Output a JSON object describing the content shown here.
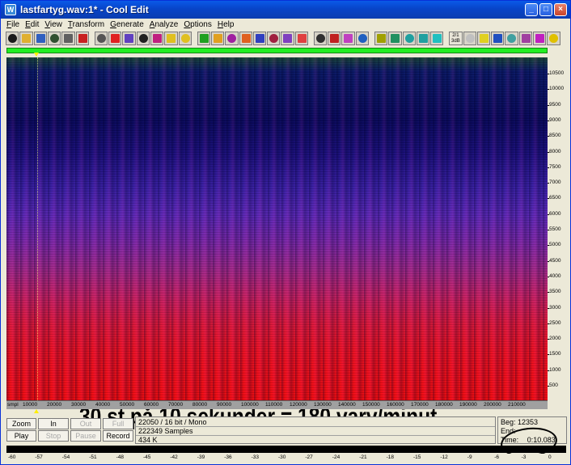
{
  "window": {
    "title": "lastfartyg.wav:1* - Cool Edit",
    "app_icon": "cool-edit-icon",
    "controls": [
      "minimize-icon",
      "maximize-icon",
      "close-icon"
    ]
  },
  "menu": [
    {
      "label": "File",
      "underline": "F",
      "rest": "ile"
    },
    {
      "label": "Edit",
      "underline": "E",
      "rest": "dit"
    },
    {
      "label": "View",
      "underline": "V",
      "rest": "iew"
    },
    {
      "label": "Transform",
      "underline": "T",
      "rest": "ransform"
    },
    {
      "label": "Generate",
      "underline": "G",
      "rest": "enerate"
    },
    {
      "label": "Analyze",
      "underline": "A",
      "rest": "nalyze"
    },
    {
      "label": "Options",
      "underline": "O",
      "rest": "ptions"
    },
    {
      "label": "Help",
      "underline": "H",
      "rest": "elp"
    }
  ],
  "toolbar": {
    "text_buttons": {
      "ratio_top": "2/1",
      "ratio_bottom": "3dB"
    },
    "colors": [
      "#1a1a1a",
      "#e0b030",
      "#3060c0",
      "#305030",
      "#606060",
      "#c82020",
      "#555555",
      "#e02020",
      "#6040c0",
      "#202020",
      "#c02080",
      "#e0c020",
      "#e0c020",
      "#20a020",
      "#e0a020",
      "#a020a0",
      "#e06020",
      "#3040c0",
      "#a02040",
      "#8040c0",
      "#e04040",
      "#303030",
      "#c02020",
      "#c040c0",
      "#2060c0",
      "#a0a000",
      "#209060",
      "#20a0a0",
      "#20a0a0",
      "#20c0c0",
      "#c0c0c0",
      "#e0d020",
      "#2050c0",
      "#40a0a0",
      "#a040a0",
      "#c020c0",
      "#e0c000"
    ]
  },
  "spectrogram": {
    "annotation": "30 st på 10 sekunder = 180 varv/minut",
    "y_ticks": [
      "10500",
      "10000",
      "9500",
      "9000",
      "8500",
      "8000",
      "7500",
      "7000",
      "6500",
      "6000",
      "5500",
      "5000",
      "4500",
      "4000",
      "3500",
      "3000",
      "2500",
      "2000",
      "1500",
      "1000",
      "500"
    ],
    "x_unit": "smpl",
    "x_ticks": [
      "10000",
      "20000",
      "30000",
      "40000",
      "50000",
      "60000",
      "70000",
      "80000",
      "90000",
      "100000",
      "110000",
      "120000",
      "130000",
      "140000",
      "150000",
      "160000",
      "170000",
      "180000",
      "190000",
      "200000",
      "210000"
    ]
  },
  "controls": {
    "zoom": "Zoom",
    "in": "In",
    "out": "Out",
    "full": "Full",
    "play": "Play",
    "stop": "Stop",
    "pause": "Pause",
    "record": "Record"
  },
  "info": {
    "format": "22050 / 16 bit / Mono",
    "samples": "222349 Samples",
    "size": "434 K"
  },
  "position": {
    "beg_label": "Beg:",
    "beg_value": "12353",
    "end_label": "End:",
    "end_value": "",
    "time_label": "Time:",
    "time_value": "0:10.083"
  },
  "level_ticks": [
    "-60",
    "-57",
    "-54",
    "-51",
    "-48",
    "-45",
    "-42",
    "-39",
    "-36",
    "-33",
    "-30",
    "-27",
    "-24",
    "-21",
    "-18",
    "-15",
    "-12",
    "-9",
    "-6",
    "-3",
    "0"
  ]
}
